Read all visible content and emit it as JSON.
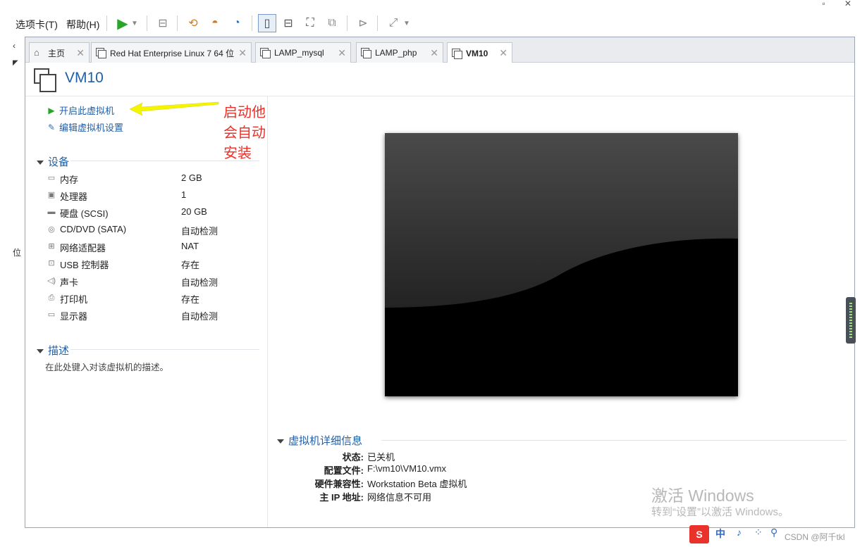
{
  "window": {
    "controls": "▫ ✕"
  },
  "menubar": {
    "items": [
      {
        "label": "选项卡(T)"
      },
      {
        "label": "帮助(H)"
      }
    ]
  },
  "left_strip": {
    "glyph_top": "‹",
    "glyph_mid": "位"
  },
  "tabs": [
    {
      "label": "主页",
      "icon": "home-icon"
    },
    {
      "label": "Red Hat Enterprise Linux 7 64 位",
      "icon": "vm-running-icon"
    },
    {
      "label": "LAMP_mysql",
      "icon": "vm-icon"
    },
    {
      "label": "LAMP_php",
      "icon": "vm-icon"
    },
    {
      "label": "VM10",
      "icon": "vm-icon",
      "active": true
    }
  ],
  "vm": {
    "title": "VM10",
    "actions": [
      {
        "label": "开启此虚拟机",
        "icon": "play-icon"
      },
      {
        "label": "编辑虚拟机设置",
        "icon": "edit-settings-icon"
      }
    ],
    "annotation": "启动他会自动安装"
  },
  "devices": {
    "heading": "设备",
    "items": [
      {
        "name": "内存",
        "value": "2 GB",
        "icon": "memory-icon"
      },
      {
        "name": "处理器",
        "value": "1",
        "icon": "cpu-icon"
      },
      {
        "name": "硬盘 (SCSI)",
        "value": "20 GB",
        "icon": "harddisk-icon"
      },
      {
        "name": "CD/DVD (SATA)",
        "value": "自动检测",
        "icon": "cdrom-icon"
      },
      {
        "name": "网络适配器",
        "value": "NAT",
        "icon": "network-icon"
      },
      {
        "name": "USB 控制器",
        "value": "存在",
        "icon": "usb-icon"
      },
      {
        "name": "声卡",
        "value": "自动检测",
        "icon": "sound-icon"
      },
      {
        "name": "打印机",
        "value": "存在",
        "icon": "printer-icon"
      },
      {
        "name": "显示器",
        "value": "自动检测",
        "icon": "monitor-icon"
      }
    ]
  },
  "description": {
    "heading": "描述",
    "placeholder": "在此处键入对该虚拟机的描述。"
  },
  "details": {
    "heading": "虚拟机详细信息",
    "rows": [
      {
        "key": "状态:",
        "value": "已关机"
      },
      {
        "key": "配置文件:",
        "value": "F:\\vm10\\VM10.vmx"
      },
      {
        "key": "硬件兼容性:",
        "value": "Workstation Beta 虚拟机"
      },
      {
        "key": "主 IP 地址:",
        "value": "网络信息不可用"
      }
    ]
  },
  "activation": {
    "line1": "激活 Windows",
    "line2": "转到“设置”以激活 Windows。"
  },
  "taskbar": {
    "ime": "中"
  },
  "watermark": "CSDN @阿千tkl",
  "colors": {
    "accent": "#1f5fa8",
    "annotation": "#e8322a",
    "arrow": "#f5f500",
    "play": "#2aa52a"
  }
}
